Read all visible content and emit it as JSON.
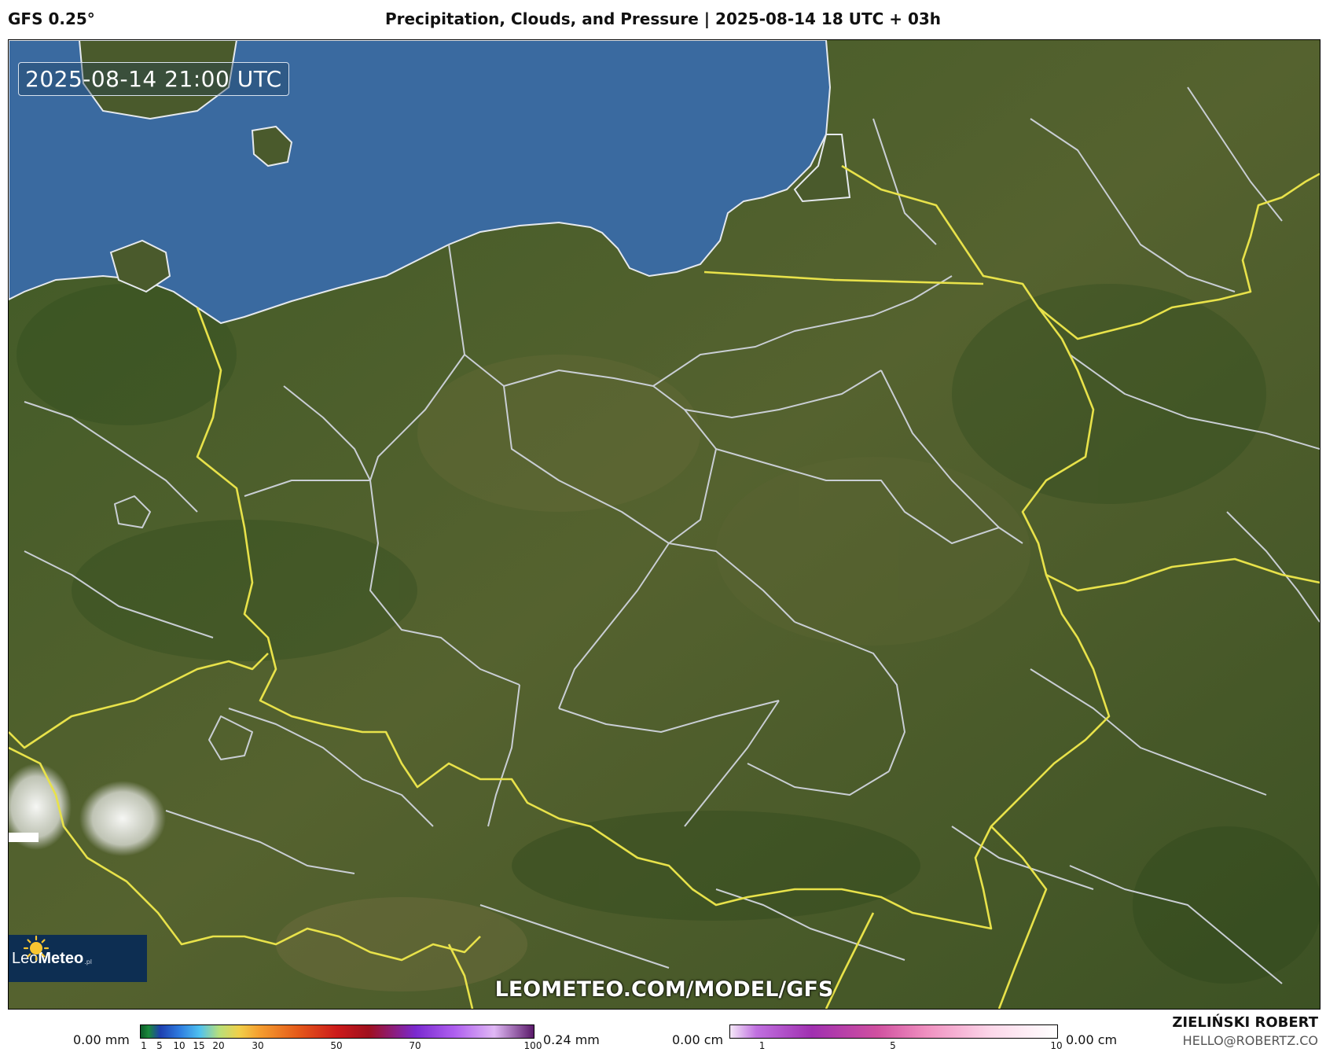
{
  "header": {
    "model_label": "GFS 0.25°",
    "title": "Precipitation, Clouds, and Pressure | 2025-08-14 18 UTC + 03h"
  },
  "map": {
    "valid_time": "2025-08-14 21:00 UTC",
    "watermark": "LEOMETEO.COM/MODEL/GFS",
    "logo": {
      "text_light": "Leo",
      "text_bold": "Meteo",
      "suffix": ".pl"
    },
    "colors": {
      "sea": "#3a6aa0",
      "land": "#4a5a2c",
      "national_border": "#e8e24a",
      "regional_border": "#c9ced4"
    }
  },
  "precip_legend": {
    "min_label": "0.00 mm",
    "max_label": "0.24 mm",
    "ticks": [
      "1",
      "5",
      "10",
      "15",
      "20",
      "30",
      "50",
      "70",
      "100"
    ],
    "tick_values": [
      1,
      5,
      10,
      15,
      20,
      30,
      50,
      70,
      100
    ],
    "range": [
      0,
      100
    ]
  },
  "snow_legend": {
    "min_label": "0.00 cm",
    "max_label": "0.00 cm",
    "ticks": [
      "1",
      "5",
      "10"
    ],
    "tick_values": [
      1,
      5,
      10
    ],
    "range": [
      0,
      10
    ]
  },
  "author": {
    "name": "ZIELIŃSKI ROBERT",
    "email": "HELLO@ROBERTZ.CO"
  }
}
